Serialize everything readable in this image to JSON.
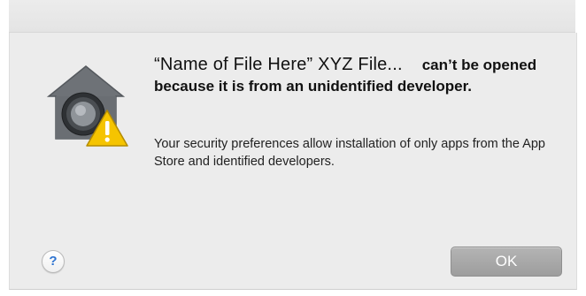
{
  "dialog": {
    "file_name": "“Name of File Here” XYZ File...",
    "headline_rest": "can’t be opened because it is from an unidentified developer.",
    "body": "Your security preferences allow installation of only apps from the App Store and identified developers.",
    "icon": "gatekeeper-warning-icon",
    "help_label": "?",
    "ok_label": "OK"
  },
  "colors": {
    "dialog_background": "#ececec",
    "warning_yellow": "#f5c400",
    "help_blue": "#2f74d0",
    "ok_button_gray": "#a8a8a8"
  }
}
